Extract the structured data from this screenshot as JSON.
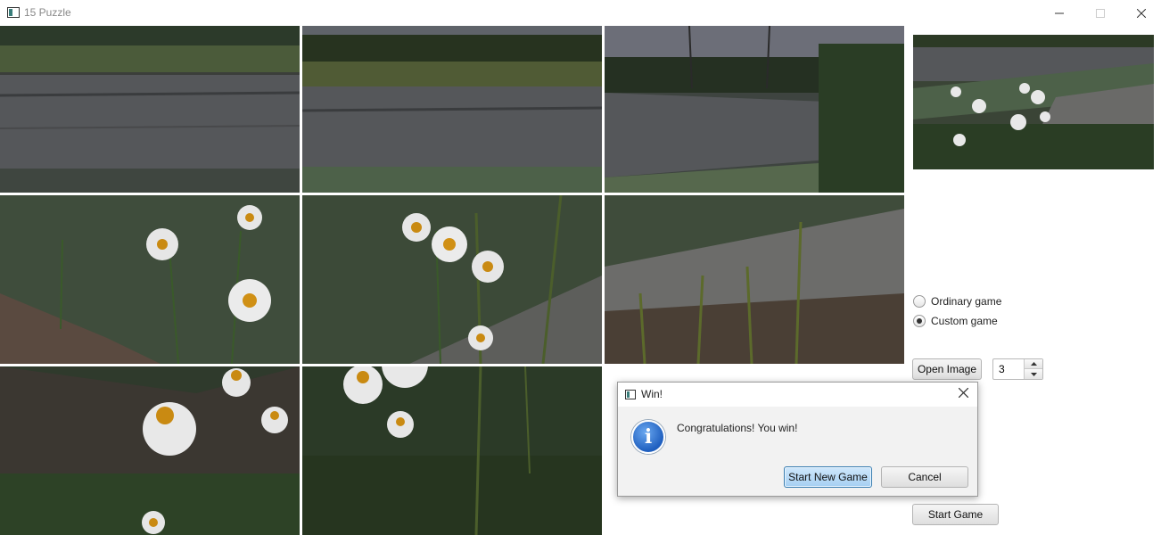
{
  "window": {
    "title": "15 Puzzle",
    "minimize_icon": "minimize-icon",
    "maximize_icon": "maximize-icon",
    "close_icon": "close-icon"
  },
  "board": {
    "grid_size": 3,
    "tile_icon": "image-tile"
  },
  "side_panel": {
    "preview_icon": "image-preview",
    "modes": [
      {
        "label": "Ordinary game",
        "selected": false
      },
      {
        "label": "Custom game",
        "selected": true
      }
    ],
    "open_image_label": "Open Image",
    "size_value": "3",
    "start_game_label": "Start Game"
  },
  "dialog": {
    "title": "Win!",
    "message": "Congratulations! You win!",
    "primary_label": "Start New Game",
    "cancel_label": "Cancel",
    "icon": "info-icon"
  },
  "colors": {
    "default_button": "#a5cff2",
    "info_blue": "#1f5fbf"
  }
}
